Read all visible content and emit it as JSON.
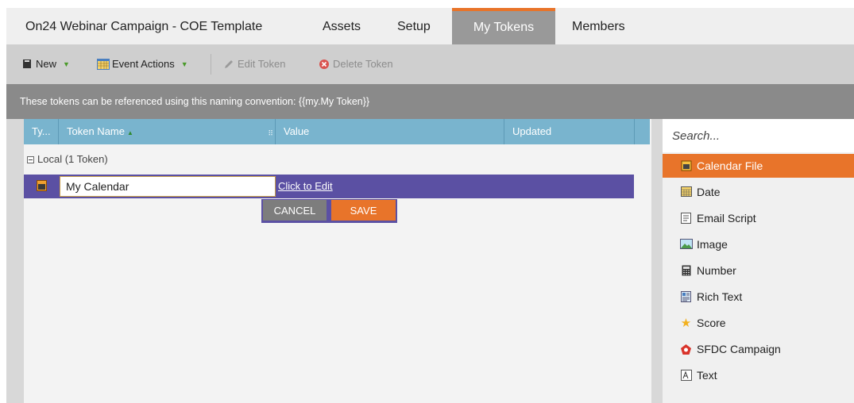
{
  "tabs": [
    {
      "label": "On24 Webinar Campaign - COE Template"
    },
    {
      "label": "Assets"
    },
    {
      "label": "Setup"
    },
    {
      "label": "My Tokens",
      "active": true
    },
    {
      "label": "Members"
    }
  ],
  "toolbar": {
    "new_label": "New",
    "event_actions_label": "Event Actions",
    "edit_token_label": "Edit Token",
    "delete_token_label": "Delete Token"
  },
  "info_text": "These tokens can be referenced using this naming convention: {{my.My Token}}",
  "grid": {
    "columns": [
      "Ty...",
      "Token Name",
      "Value",
      "Updated"
    ],
    "group_label": "Local (1 Token)",
    "editing_row": {
      "name_value": "My Calendar",
      "value_link": "Click to Edit"
    },
    "cancel_label": "CANCEL",
    "save_label": "SAVE"
  },
  "panel": {
    "search_placeholder": "Search...",
    "types": [
      {
        "label": "Calendar File",
        "icon": "calendar-file-icon",
        "active": true
      },
      {
        "label": "Date",
        "icon": "date-icon"
      },
      {
        "label": "Email Script",
        "icon": "email-script-icon"
      },
      {
        "label": "Image",
        "icon": "image-icon"
      },
      {
        "label": "Number",
        "icon": "number-icon"
      },
      {
        "label": "Rich Text",
        "icon": "rich-text-icon"
      },
      {
        "label": "Score",
        "icon": "score-icon"
      },
      {
        "label": "SFDC Campaign",
        "icon": "sfdc-campaign-icon"
      },
      {
        "label": "Text",
        "icon": "text-icon"
      }
    ]
  },
  "colors": {
    "accent_orange": "#e8742a",
    "selection_purple": "#5b50a3",
    "grid_header_blue": "#79b4ce"
  }
}
